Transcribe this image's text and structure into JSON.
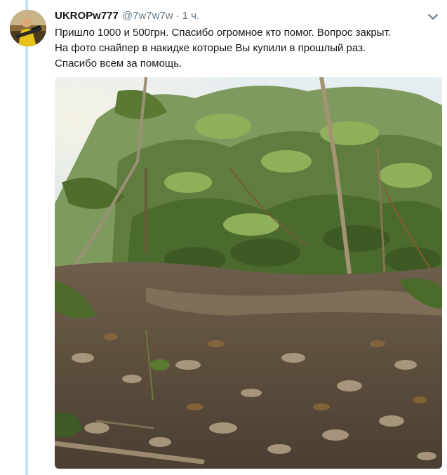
{
  "tweet": {
    "display_name": "UKROPw777",
    "username": "@7w7w7w",
    "separator": "·",
    "timestamp": "1 ч.",
    "text_lines": [
      "Пришло 1000 и 500грн. Спасибо огромное кто помог. Вопрос закрыт.",
      "На фото снайпер в накидке которые Вы купили в прошлый раз.",
      "Спасибо всем за помощь."
    ]
  },
  "icons": {
    "menu": "chevron-down-icon",
    "avatar": "user-avatar"
  },
  "colors": {
    "thread_line": "#c4e2f5",
    "name": "#14171a",
    "meta": "#657786"
  }
}
